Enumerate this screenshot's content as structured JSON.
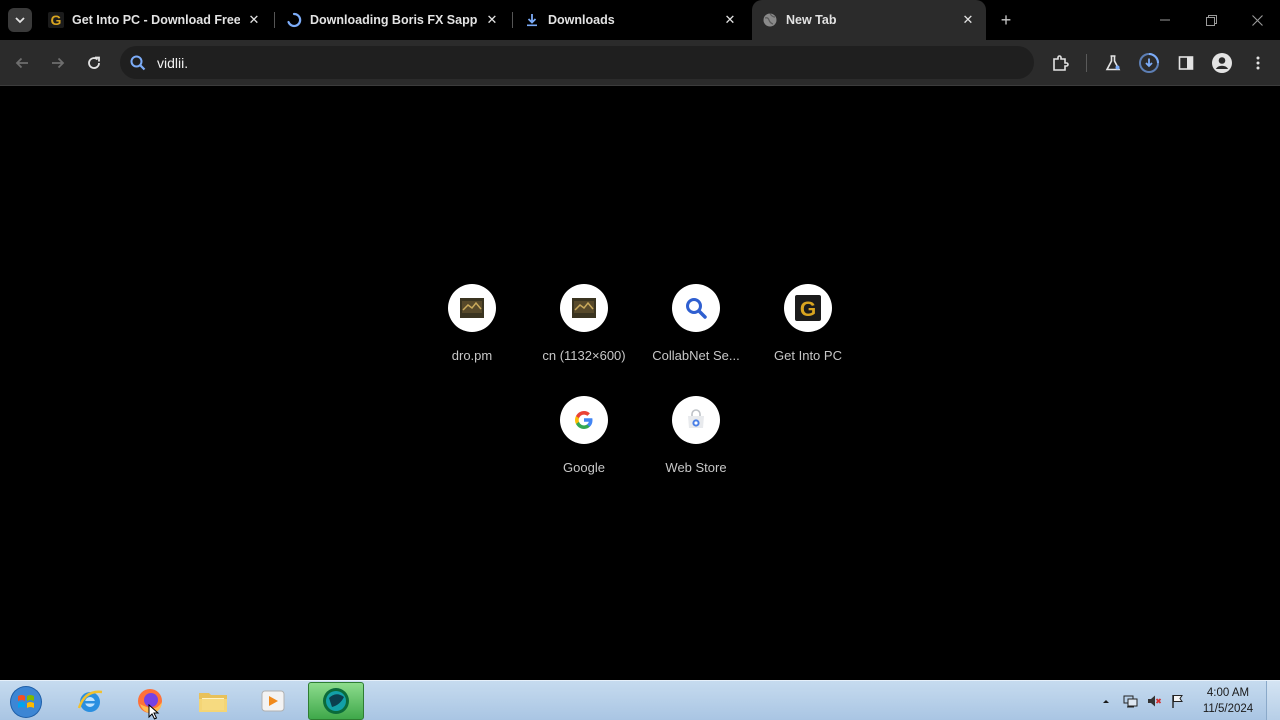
{
  "tabs": [
    {
      "title": "Get Into PC - Download Free Y",
      "favicon": "getintopc-icon"
    },
    {
      "title": "Downloading Boris FX Sapphire",
      "favicon": "loading-spinner-icon"
    },
    {
      "title": "Downloads",
      "favicon": "download-icon"
    },
    {
      "title": "New Tab",
      "favicon": "globe-icon"
    }
  ],
  "omnibox": {
    "value": "vidlii."
  },
  "shortcuts": [
    {
      "label": "dro.pm",
      "icon": "thumbnail-icon"
    },
    {
      "label": "cn (1132×600)",
      "icon": "thumbnail-icon"
    },
    {
      "label": "CollabNet Se...",
      "icon": "search-icon"
    },
    {
      "label": "Get Into PC",
      "icon": "getintopc-icon"
    },
    {
      "label": "Google",
      "icon": "google-icon"
    },
    {
      "label": "Web Store",
      "icon": "webstore-icon"
    }
  ],
  "clock": {
    "time": "4:00 AM",
    "date": "11/5/2024"
  },
  "colors": {
    "accent": "#7cacf8",
    "background": "#000000",
    "toolbar": "#2b2b2b",
    "getintopc_gold": "#d9a520"
  }
}
